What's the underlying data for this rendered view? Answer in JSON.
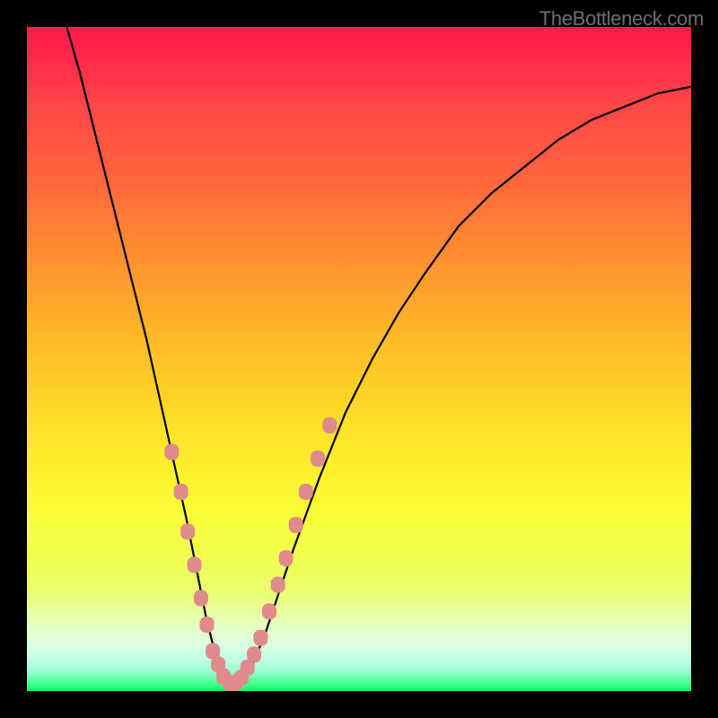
{
  "attribution": "TheBottleneck.com",
  "colors": {
    "gradient_top": "#ff1a4a",
    "gradient_bottom": "#00ff6e",
    "curve": "#000000",
    "marker": "#e08b8b",
    "frame": "#000000"
  },
  "chart_data": {
    "type": "line",
    "title": "",
    "xlabel": "",
    "ylabel": "",
    "xlim": [
      0,
      100
    ],
    "ylim": [
      0,
      100
    ],
    "grid": false,
    "series": [
      {
        "name": "bottleneck-curve",
        "x": [
          6,
          8,
          10,
          12,
          14,
          16,
          18,
          20,
          22,
          24,
          25,
          26,
          27,
          28,
          29,
          30,
          31,
          32,
          33,
          34,
          36,
          38,
          40,
          44,
          48,
          52,
          56,
          60,
          65,
          70,
          75,
          80,
          85,
          90,
          95,
          100
        ],
        "y": [
          100,
          93,
          85,
          77,
          69,
          61,
          53,
          44,
          35,
          26,
          21,
          16,
          11,
          7,
          4,
          2,
          1,
          1,
          2,
          4,
          9,
          15,
          21,
          32,
          42,
          50,
          57,
          63,
          70,
          75,
          79,
          83,
          86,
          88,
          90,
          91
        ]
      }
    ],
    "markers": [
      {
        "x": 21.8,
        "y": 36
      },
      {
        "x": 23.2,
        "y": 30
      },
      {
        "x": 24.2,
        "y": 24
      },
      {
        "x": 25.2,
        "y": 19
      },
      {
        "x": 26.2,
        "y": 14
      },
      {
        "x": 27.1,
        "y": 10
      },
      {
        "x": 28.0,
        "y": 6
      },
      {
        "x": 28.8,
        "y": 4
      },
      {
        "x": 29.6,
        "y": 2.2
      },
      {
        "x": 30.5,
        "y": 1.2
      },
      {
        "x": 31.4,
        "y": 1.2
      },
      {
        "x": 32.3,
        "y": 2.0
      },
      {
        "x": 33.2,
        "y": 3.5
      },
      {
        "x": 34.2,
        "y": 5.5
      },
      {
        "x": 35.2,
        "y": 8.0
      },
      {
        "x": 36.5,
        "y": 12
      },
      {
        "x": 37.8,
        "y": 16
      },
      {
        "x": 39.0,
        "y": 20
      },
      {
        "x": 40.5,
        "y": 25
      },
      {
        "x": 42.0,
        "y": 30
      },
      {
        "x": 43.8,
        "y": 35
      },
      {
        "x": 45.6,
        "y": 40
      }
    ]
  }
}
